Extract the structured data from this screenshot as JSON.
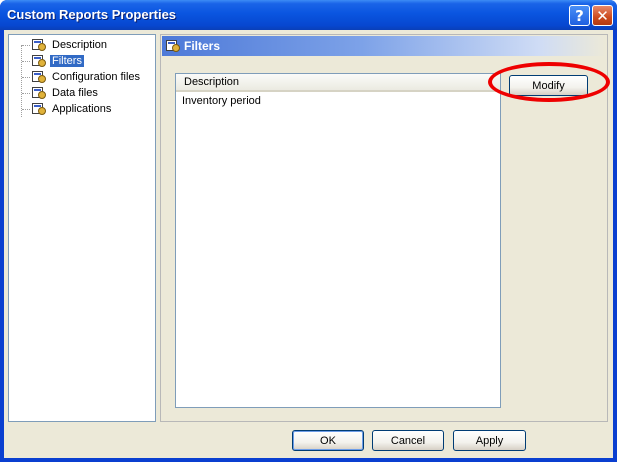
{
  "window": {
    "title": "Custom Reports Properties",
    "help_glyph": "?",
    "close_glyph": "✕"
  },
  "tree": {
    "items": [
      {
        "label": "Description",
        "icon": "report-gear-icon",
        "selected": false
      },
      {
        "label": "Filters",
        "icon": "report-gear-icon",
        "selected": true
      },
      {
        "label": "Configuration files",
        "icon": "report-gear-icon",
        "selected": false
      },
      {
        "label": "Data files",
        "icon": "report-gear-icon",
        "selected": false
      },
      {
        "label": "Applications",
        "icon": "report-gear-icon",
        "selected": false
      }
    ]
  },
  "panel": {
    "title": "Filters",
    "list": {
      "column_header": "Description",
      "rows": [
        "Inventory period"
      ]
    },
    "modify_label": "Modify"
  },
  "footer": {
    "ok_label": "OK",
    "cancel_label": "Cancel",
    "apply_label": "Apply"
  },
  "colors": {
    "titlebar": "#0a55e0",
    "selection": "#316ac5",
    "highlight_ring": "#ee0000"
  }
}
